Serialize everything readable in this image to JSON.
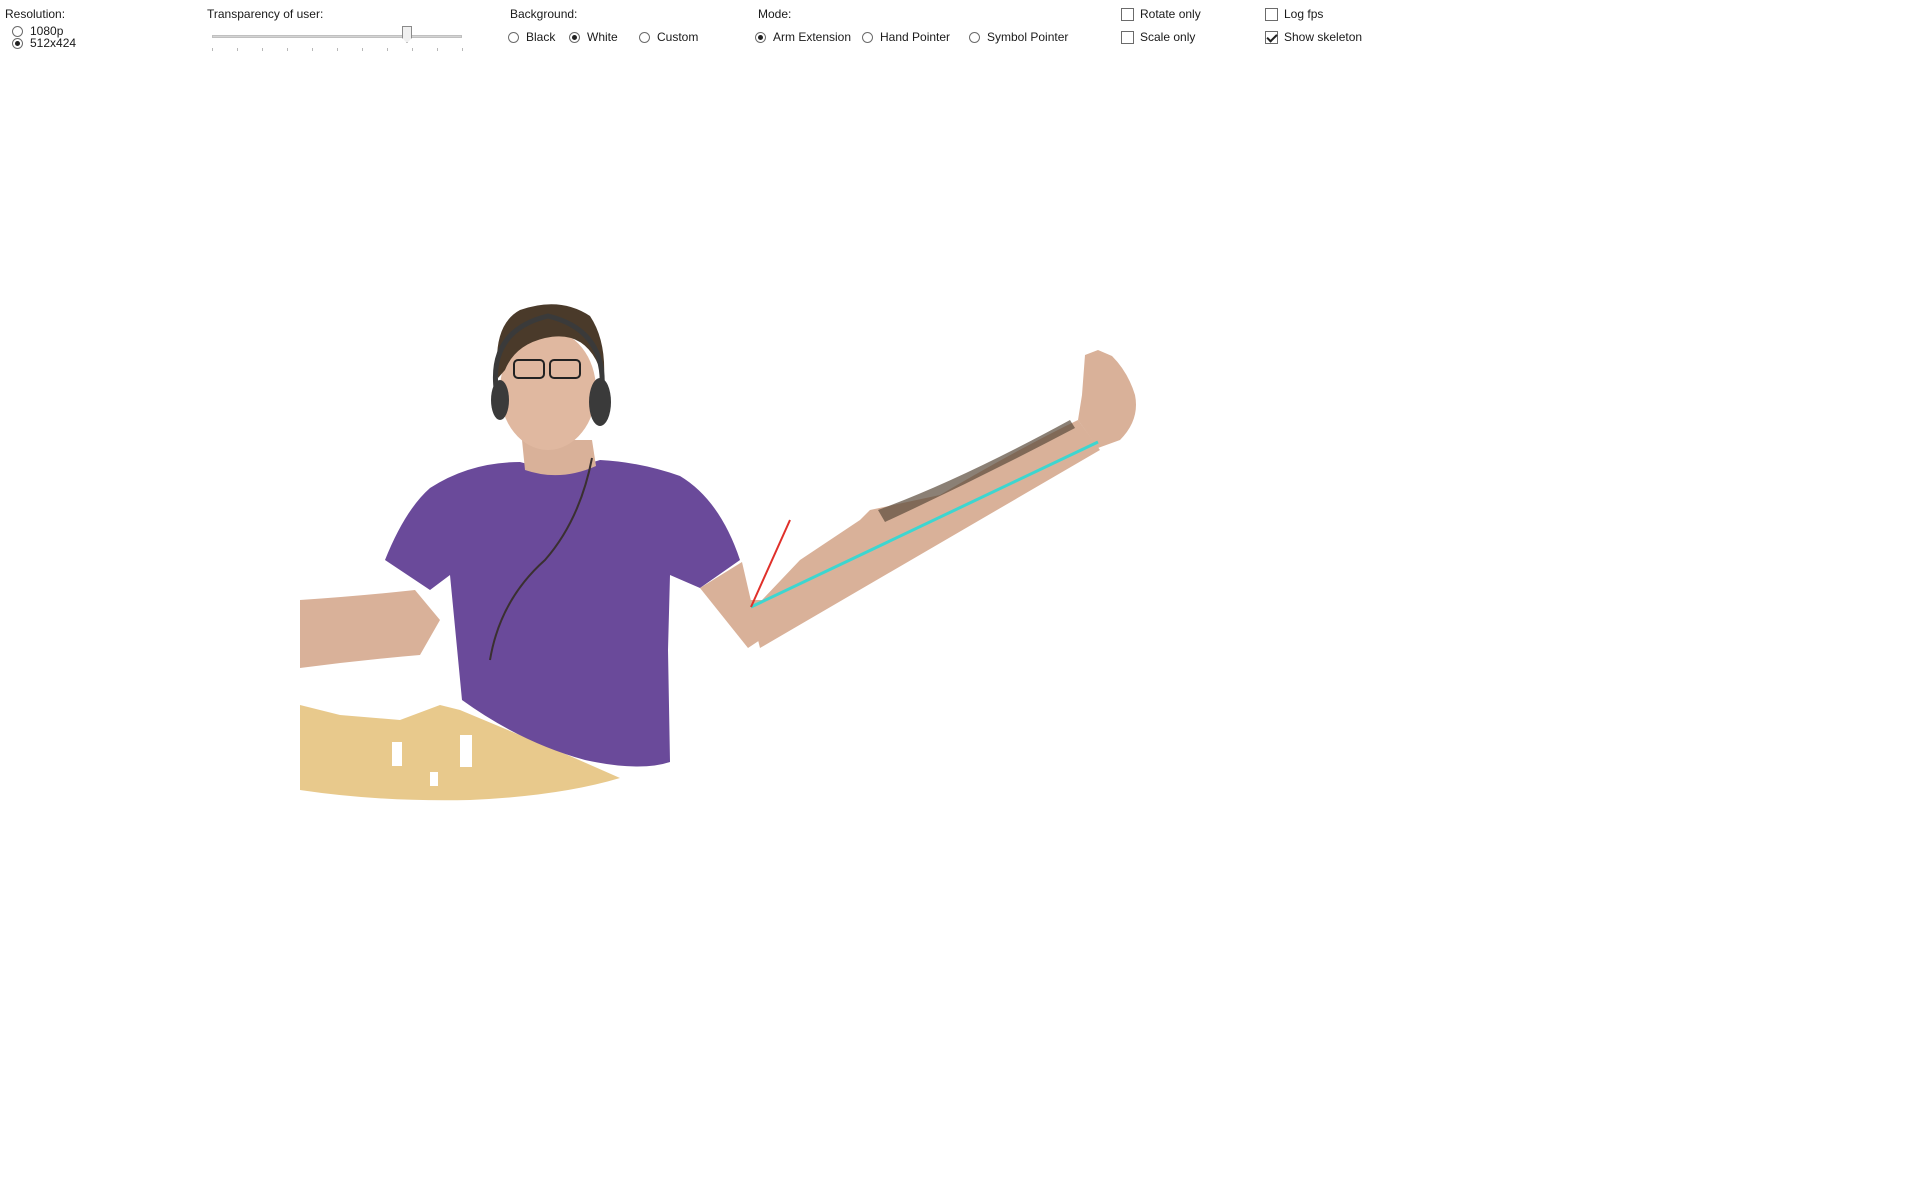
{
  "resolution": {
    "label": "Resolution:",
    "options": [
      {
        "label": "1080p",
        "checked": false
      },
      {
        "label": "512x424",
        "checked": true
      }
    ]
  },
  "transparency": {
    "label": "Transparency of user:",
    "value": 0.78,
    "tick_count": 11
  },
  "background": {
    "label": "Background:",
    "options": [
      {
        "label": "Black",
        "checked": false
      },
      {
        "label": "White",
        "checked": true
      },
      {
        "label": "Custom",
        "checked": false
      }
    ]
  },
  "mode": {
    "label": "Mode:",
    "options": [
      {
        "label": "Arm Extension",
        "checked": true
      },
      {
        "label": "Hand Pointer",
        "checked": false
      },
      {
        "label": "Symbol Pointer",
        "checked": false
      }
    ]
  },
  "checks": {
    "rotate_only": {
      "label": "Rotate only",
      "checked": false
    },
    "scale_only": {
      "label": "Scale only",
      "checked": false
    },
    "log_fps": {
      "label": "Log fps",
      "checked": false
    },
    "show_skeleton": {
      "label": "Show skeleton",
      "checked": true
    }
  },
  "colors": {
    "skeleton_arm": "#3dd6d0",
    "skeleton_ref": "#e0302a",
    "shirt": "#6a4a9a",
    "skin": "#d9b199",
    "desk": "#e8c98c",
    "hair": "#4a3a2a"
  }
}
